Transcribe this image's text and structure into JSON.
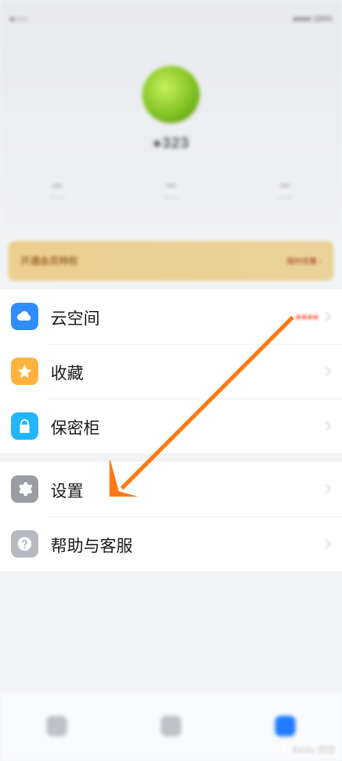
{
  "status": {
    "left": "●○○○",
    "right": "●●●● 100%"
  },
  "profile": {
    "username": "●323",
    "stats": [
      {
        "num": "—",
        "label": "——"
      },
      {
        "num": "—",
        "label": "——"
      },
      {
        "num": "—",
        "label": "——"
      }
    ]
  },
  "banner": {
    "left": "开通会员特权",
    "right": "限时优惠 ›"
  },
  "menu": {
    "group1": [
      {
        "key": "cloud",
        "label": "云空间",
        "extra": "●●●●"
      },
      {
        "key": "fav",
        "label": "收藏",
        "extra": ""
      },
      {
        "key": "safe",
        "label": "保密柜",
        "extra": ""
      }
    ],
    "group2": [
      {
        "key": "settings",
        "label": "设置",
        "extra": ""
      },
      {
        "key": "help",
        "label": "帮助与客服",
        "extra": ""
      }
    ]
  },
  "nav": [
    {
      "label": ""
    },
    {
      "label": ""
    },
    {
      "label": ""
    }
  ],
  "watermark": "Baidu 经验"
}
